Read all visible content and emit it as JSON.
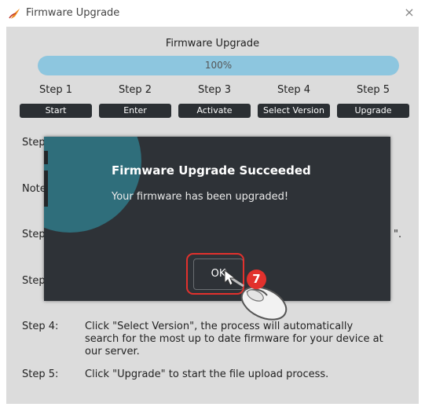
{
  "window": {
    "title": "Firmware Upgrade",
    "close_symbol": "×"
  },
  "upgrade": {
    "heading": "Firmware Upgrade",
    "progress_text": "100%",
    "progress_value": 100,
    "steps": [
      {
        "label": "Step 1",
        "button": "Start"
      },
      {
        "label": "Step 2",
        "button": "Enter"
      },
      {
        "label": "Step 3",
        "button": "Activate"
      },
      {
        "label": "Step 4",
        "button": "Select Version"
      },
      {
        "label": "Step 5",
        "button": "Upgrade"
      }
    ]
  },
  "background_rows": {
    "row1": "Step",
    "row2": "Note",
    "row3": "Step",
    "row3_suffix": "\".",
    "row4": "Step"
  },
  "instructions": [
    {
      "step": "Step 4:",
      "text": "Click \"Select Version\", the process will automatically search for the most up to date firmware for your device at our server."
    },
    {
      "step": "Step 5:",
      "text": "Click \"Upgrade\" to start the file upload process."
    }
  ],
  "dialog": {
    "title": "Firmware Upgrade Succeeded",
    "message": "Your firmware has been upgraded!",
    "ok_label": "OK",
    "icon": "info-icon"
  },
  "annotation": {
    "badge_number": "7",
    "accent": "#e2312d",
    "icon": "mouse-icon"
  }
}
